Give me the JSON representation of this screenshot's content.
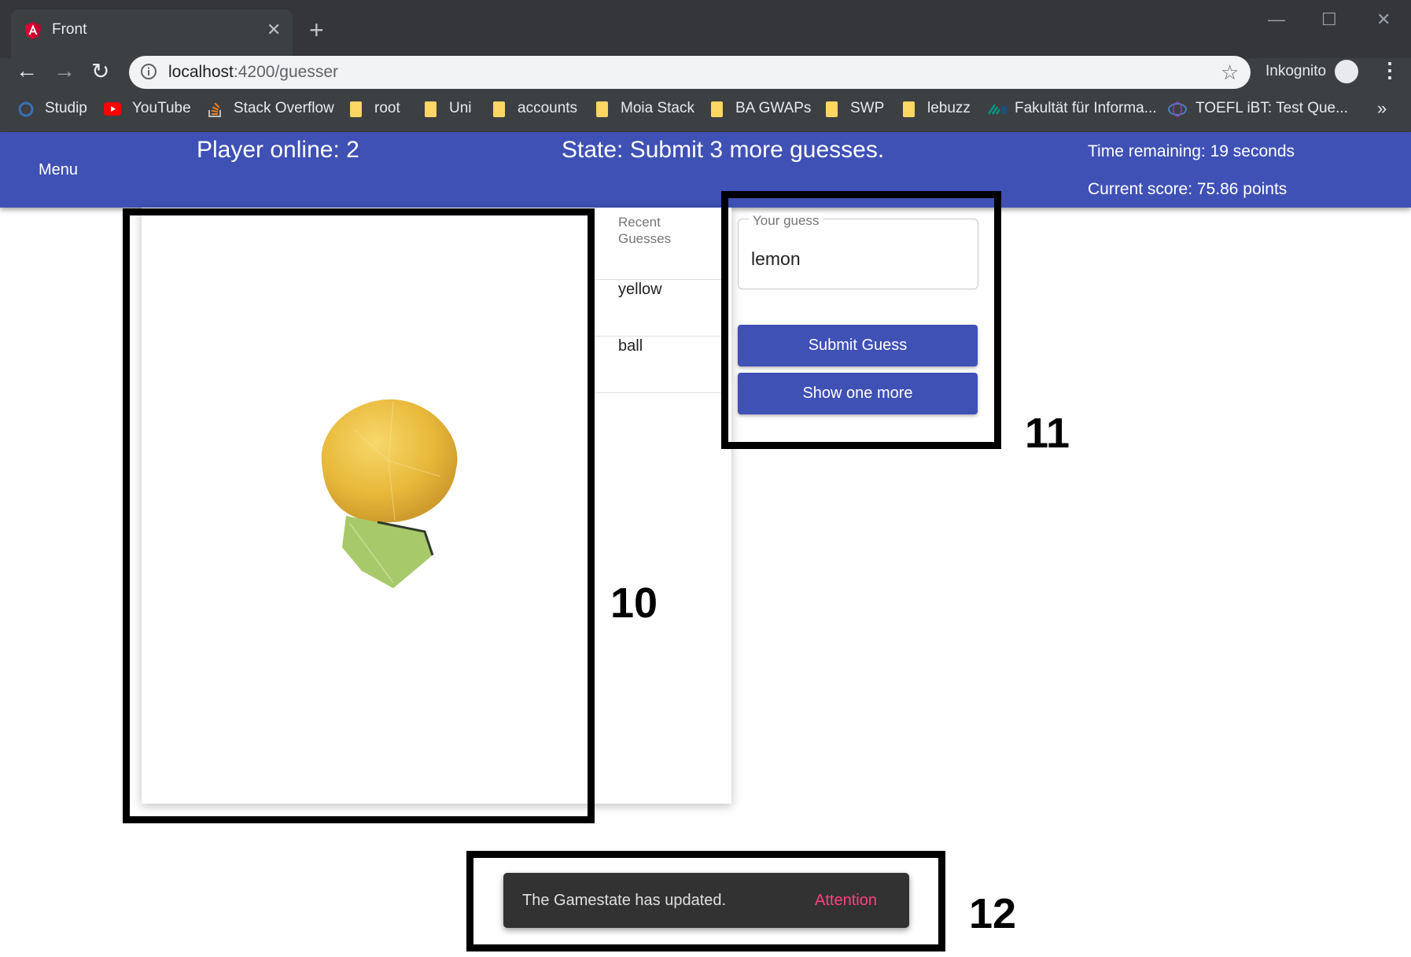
{
  "browser": {
    "tab_title": "Front",
    "url_host": "localhost",
    "url_path": ":4200/guesser",
    "incognito_label": "Inkognito",
    "more_bookmarks": "»",
    "bookmarks": [
      {
        "label": "Studip",
        "icon": "studip-icon"
      },
      {
        "label": "YouTube",
        "icon": "youtube-icon"
      },
      {
        "label": "Stack Overflow",
        "icon": "stackoverflow-icon"
      },
      {
        "label": "root",
        "icon": "folder-icon"
      },
      {
        "label": "Uni",
        "icon": "folder-icon"
      },
      {
        "label": "accounts",
        "icon": "folder-icon"
      },
      {
        "label": "Moia Stack",
        "icon": "folder-icon"
      },
      {
        "label": "BA GWAPs",
        "icon": "folder-icon"
      },
      {
        "label": "SWP",
        "icon": "folder-icon"
      },
      {
        "label": "lebuzz",
        "icon": "folder-icon"
      },
      {
        "label": "Fakultät für Informa...",
        "icon": "kit-icon"
      },
      {
        "label": "TOEFL iBT: Test Que...",
        "icon": "ets-icon"
      }
    ]
  },
  "header": {
    "menu_label": "Menu",
    "players_online": "Player online: 2",
    "state": "State: Submit 3 more guesses.",
    "time_remaining": "Time remaining: 19 seconds",
    "current_score": "Current score: 75.86 points"
  },
  "guesses": {
    "header": "Recent Guesses",
    "items": [
      "yellow",
      "ball"
    ]
  },
  "form": {
    "label": "Your guess",
    "value": "lemon",
    "submit_label": "Submit Guess",
    "show_more_label": "Show one more"
  },
  "annotations": {
    "image_box": "10",
    "form_box": "11",
    "snackbar_box": "12"
  },
  "snackbar": {
    "message": "The Gamestate has updated.",
    "action": "Attention"
  },
  "colors": {
    "primary": "#3f51b5",
    "snackbar_bg": "#323232",
    "snackbar_action": "#ff4081",
    "browser_frame": "#35363a"
  }
}
